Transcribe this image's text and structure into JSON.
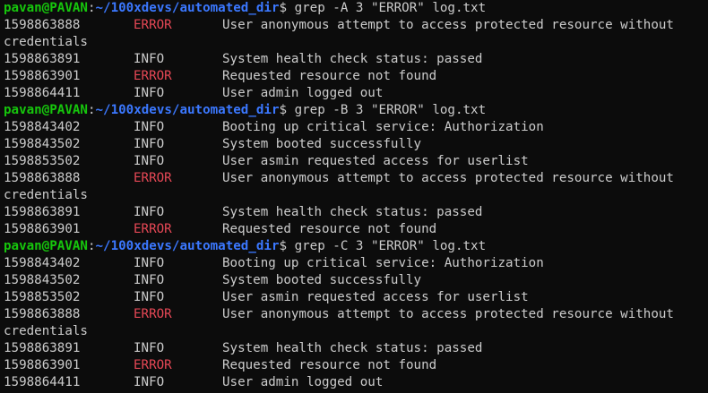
{
  "colors": {
    "background": "#0c0c0c",
    "text": "#cccccc",
    "prompt_user": "#16c60c",
    "prompt_path": "#3b78ff",
    "error": "#e74856"
  },
  "prompt": {
    "user_host": "pavan@PAVAN",
    "colon": ":",
    "path": "~/100xdevs/automated_dir",
    "dollar": "$"
  },
  "blocks": [
    {
      "command": " grep -A 3 \"ERROR\" log.txt",
      "rows": [
        {
          "ts": "1598863888",
          "level": "ERROR",
          "msg": "User anonymous attempt to access protected resource without"
        },
        {
          "wrap": "credentials"
        },
        {
          "ts": "1598863891",
          "level": "INFO",
          "msg": "System health check status: passed"
        },
        {
          "ts": "1598863901",
          "level": "ERROR",
          "msg": "Requested resource not found"
        },
        {
          "ts": "1598864411",
          "level": "INFO",
          "msg": "User admin logged out"
        }
      ]
    },
    {
      "command": " grep -B 3 \"ERROR\" log.txt",
      "rows": [
        {
          "ts": "1598843402",
          "level": "INFO",
          "msg": "Booting up critical service: Authorization"
        },
        {
          "ts": "1598843502",
          "level": "INFO",
          "msg": "System booted successfully"
        },
        {
          "ts": "1598853502",
          "level": "INFO",
          "msg": "User asmin requested access for userlist"
        },
        {
          "ts": "1598863888",
          "level": "ERROR",
          "msg": "User anonymous attempt to access protected resource without"
        },
        {
          "wrap": "credentials"
        },
        {
          "ts": "1598863891",
          "level": "INFO",
          "msg": "System health check status: passed"
        },
        {
          "ts": "1598863901",
          "level": "ERROR",
          "msg": "Requested resource not found"
        }
      ]
    },
    {
      "command": " grep -C 3 \"ERROR\" log.txt",
      "rows": [
        {
          "ts": "1598843402",
          "level": "INFO",
          "msg": "Booting up critical service: Authorization"
        },
        {
          "ts": "1598843502",
          "level": "INFO",
          "msg": "System booted successfully"
        },
        {
          "ts": "1598853502",
          "level": "INFO",
          "msg": "User asmin requested access for userlist"
        },
        {
          "ts": "1598863888",
          "level": "ERROR",
          "msg": "User anonymous attempt to access protected resource without"
        },
        {
          "wrap": "credentials"
        },
        {
          "ts": "1598863891",
          "level": "INFO",
          "msg": "System health check status: passed"
        },
        {
          "ts": "1598863901",
          "level": "ERROR",
          "msg": "Requested resource not found"
        },
        {
          "ts": "1598864411",
          "level": "INFO",
          "msg": "User admin logged out"
        }
      ]
    }
  ]
}
